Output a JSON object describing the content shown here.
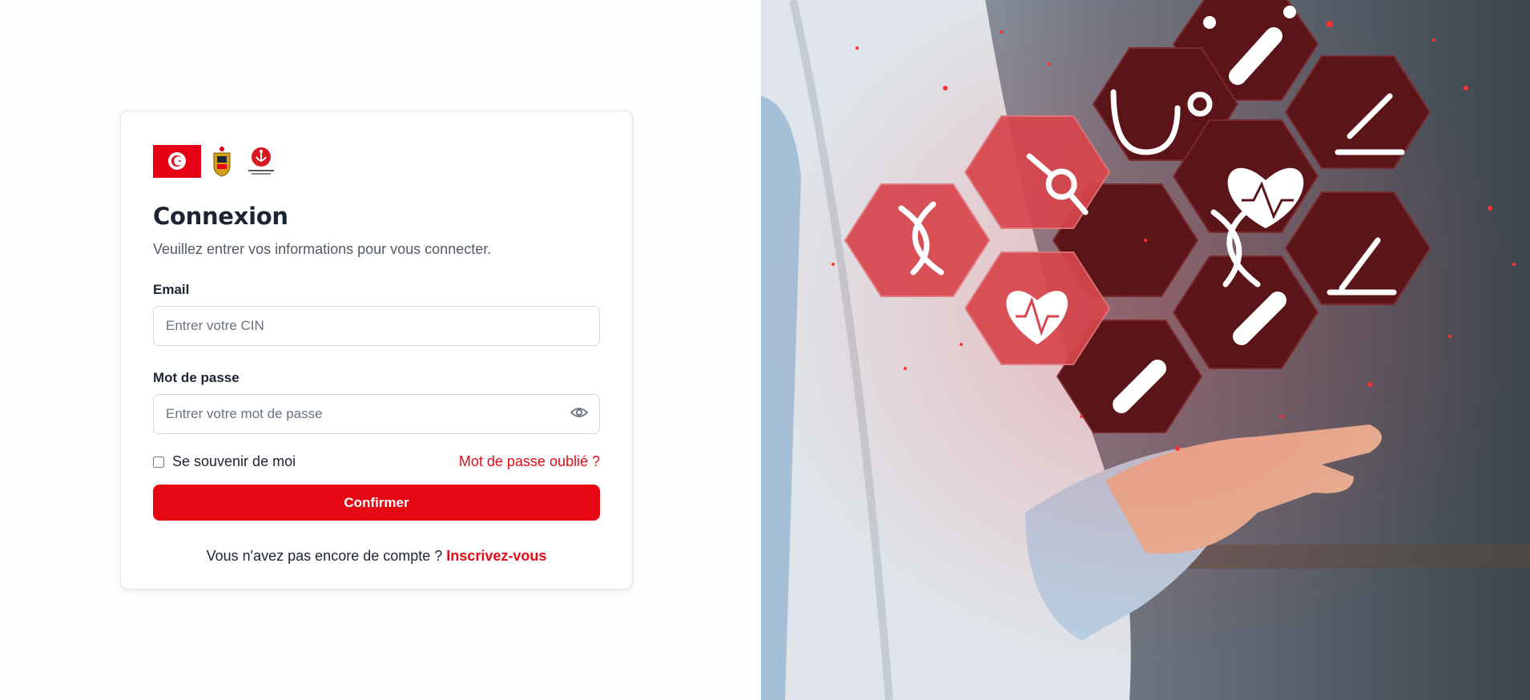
{
  "logos": {
    "flag": "tunisia-flag-icon",
    "emblem": "tunisia-coat-of-arms-icon",
    "ministry": "ministry-logo-icon"
  },
  "login": {
    "title": "Connexion",
    "subtitle": "Veuillez entrer vos informations pour vous connecter.",
    "email_label": "Email",
    "email_placeholder": "Entrer votre CIN",
    "password_label": "Mot de passe",
    "password_placeholder": "Entrer votre mot de passe",
    "remember_label": "Se souvenir de moi",
    "forgot_label": "Mot de passe oublié ?",
    "confirm_label": "Confirmer",
    "signup_prompt": "Vous n'avez pas encore de compte ?",
    "signup_link": "Inscrivez-vous"
  },
  "hero": {
    "icons": [
      "dna-icon",
      "molecule-icon",
      "stethoscope-icon",
      "pills-icon",
      "microscope-icon",
      "heart-pulse-icon",
      "capsule-icon"
    ]
  },
  "colors": {
    "accent": "#e50914",
    "link": "#e30b17",
    "text": "#1d2433"
  }
}
